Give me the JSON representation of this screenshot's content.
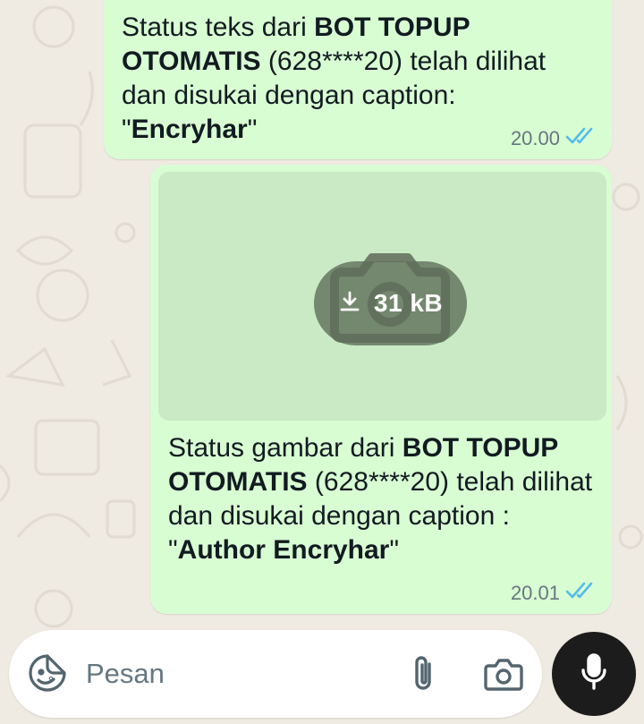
{
  "conversation": {
    "messages": [
      {
        "segments": [
          {
            "text": "Status teks dari ",
            "bold": false
          },
          {
            "text": "BOT TOPUP OTOMATIS",
            "bold": true
          },
          {
            "text": " (628****20) telah dilihat dan disukai dengan caption: \"",
            "bold": false
          },
          {
            "text": "Encryhar",
            "bold": true
          },
          {
            "text": "\"",
            "bold": false
          }
        ],
        "time": "20.00",
        "status_icon": "double-check-read-icon"
      },
      {
        "media": {
          "size": "31 kB",
          "icon": "download-icon",
          "placeholder_icon": "camera-icon"
        },
        "segments": [
          {
            "text": "Status gambar dari ",
            "bold": false
          },
          {
            "text": "BOT TOPUP OTOMATIS",
            "bold": true
          },
          {
            "text": " (628****20) telah dilihat dan disukai dengan caption : \"",
            "bold": false
          },
          {
            "text": "Author Encryhar",
            "bold": true
          },
          {
            "text": "\"",
            "bold": false
          }
        ],
        "time": "20.01",
        "status_icon": "double-check-read-icon"
      }
    ]
  },
  "composer": {
    "placeholder": "Pesan",
    "value": "",
    "icons": [
      "emoji-sticker-icon",
      "paperclip-icon",
      "camera-icon",
      "microphone-icon"
    ]
  },
  "colors": {
    "background": "#efeae2",
    "bubble_outgoing": "#d9fdd3",
    "read_ticks": "#53bdeb",
    "meta_text": "#667781",
    "mic_button": "#1c1c1c"
  }
}
